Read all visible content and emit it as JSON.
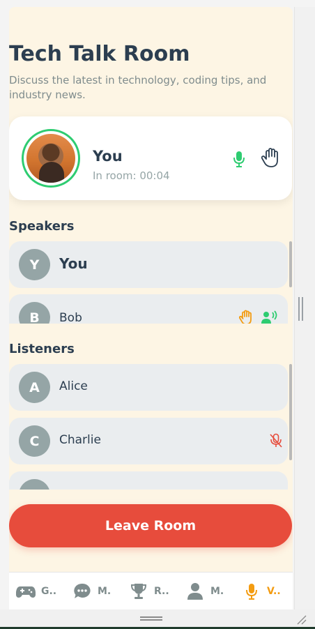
{
  "room": {
    "title": "Tech Talk Room",
    "description": "Discuss the latest in technology, coding tips, and industry news."
  },
  "me": {
    "name": "You",
    "status": "In room: 00:04",
    "mic_icon": "mic-on-icon",
    "hand_icon": "raise-hand-icon"
  },
  "speakers": {
    "title": "Speakers",
    "items": [
      {
        "initial": "Y",
        "name": "You"
      },
      {
        "initial": "B",
        "name": "Bob",
        "icons": [
          "hand-raised-icon",
          "speaking-icon"
        ]
      }
    ]
  },
  "listeners": {
    "title": "Listeners",
    "items": [
      {
        "initial": "A",
        "name": "Alice"
      },
      {
        "initial": "C",
        "name": "Charlie",
        "icons": [
          "mic-muted-icon"
        ]
      },
      {
        "initial": "",
        "name": ""
      }
    ]
  },
  "actions": {
    "leave_label": "Leave Room"
  },
  "tabs": [
    {
      "label": "G..",
      "icon": "gamepad-icon",
      "active": false
    },
    {
      "label": "M.",
      "icon": "chat-bubble-icon",
      "active": false
    },
    {
      "label": "R..",
      "icon": "trophy-icon",
      "active": false
    },
    {
      "label": "M.",
      "icon": "person-icon",
      "active": false
    },
    {
      "label": "V..",
      "icon": "microphone-icon",
      "active": true
    }
  ],
  "colors": {
    "background": "#fdf5e4",
    "accent_active": "#f39c12",
    "danger": "#e74c3c",
    "success": "#2ecc71",
    "text_primary": "#2c3e50",
    "avatar_gray": "#95a5a6"
  }
}
